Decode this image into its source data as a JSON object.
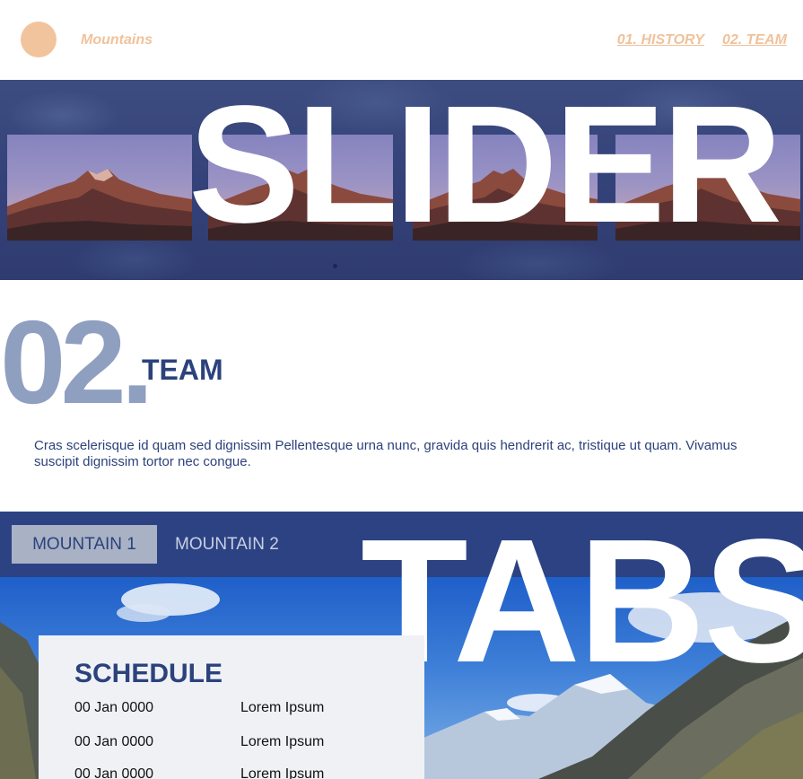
{
  "header": {
    "brand": "Mountains",
    "nav": [
      "01. HISTORY",
      "02. TEAM"
    ]
  },
  "slider": {
    "word": "SLIDER"
  },
  "team": {
    "number": "02.",
    "title": "TEAM",
    "text": "Cras scelerisque id quam sed dignissim Pellentesque urna nunc, gravida quis hendrerit ac, tristique ut quam. Vivamus suscipit dignissim tortor nec congue."
  },
  "tabs": {
    "items": [
      "MOUNTAIN 1",
      "MOUNTAIN 2"
    ],
    "word": "TABS"
  },
  "schedule": {
    "title": "SCHEDULE",
    "rows": [
      {
        "date": "00 Jan 0000",
        "name": "Lorem Ipsum"
      },
      {
        "date": "00 Jan 0000",
        "name": "Lorem Ipsum"
      },
      {
        "date": "00 Jan 0000",
        "name": "Lorem Ipsum"
      }
    ]
  },
  "colors": {
    "accent": "#f0c29b",
    "navy": "#2c427c",
    "team_number": "#8f9fc0"
  }
}
